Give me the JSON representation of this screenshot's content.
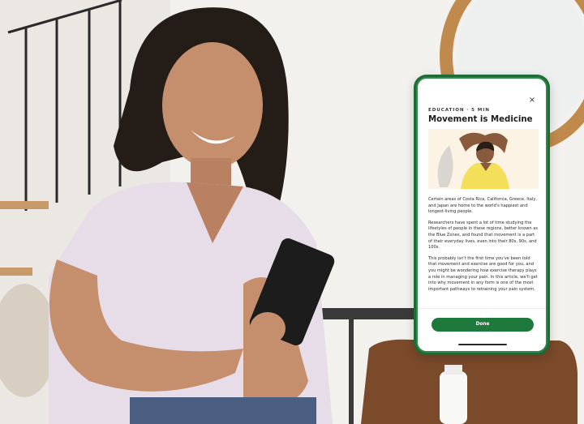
{
  "article": {
    "eyebrow": "EDUCATION · 5 MIN",
    "title": "Movement is Medicine",
    "paragraphs": [
      "Certain areas of Costa Rica, California, Greece, Italy, and Japan are home to the world's happiest and longest-living people.",
      "Researchers have spent a lot of time studying the lifestyles of people in these regions, better known as the Blue Zones, and found that movement is a part of their everyday lives, even into their 80s, 90s, and 100s.",
      "This probably isn't the first time you've been told that movement and exercise are good for you, and you might be wondering how exercise therapy plays a role in managing your pain. In this article, we'll get into why movement in any form is one of the most important pathways to retraining your pain system."
    ]
  },
  "actions": {
    "close_glyph": "×",
    "done_label": "Done"
  },
  "theme": {
    "brand_green": "#1e7a3c",
    "phone_frame": "#1f6b35",
    "hero_bg": "#fdf3e4",
    "shirt_yellow": "#f4df5a"
  }
}
